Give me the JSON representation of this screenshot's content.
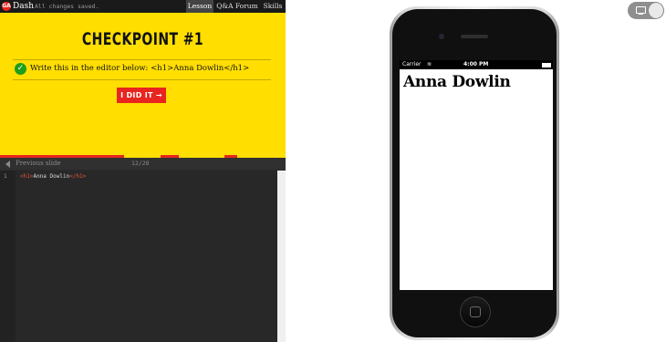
{
  "header": {
    "logo_text": "GA",
    "brand": "Dash",
    "save_status": "All changes saved.",
    "tabs": [
      {
        "label": "Lesson",
        "active": true
      },
      {
        "label": "Q&A Forum",
        "active": false
      },
      {
        "label": "Skills",
        "active": false
      }
    ]
  },
  "lesson": {
    "title": "CHECKPOINT #1",
    "instruction": "Write this in the editor below: <h1>Anna Dowlin</h1>",
    "button_label": "I DID IT →"
  },
  "slide_nav": {
    "previous_label": "Previous slide",
    "counter": "12/28"
  },
  "editor": {
    "line_number": "1",
    "code_open_tag": "<h1>",
    "code_text": "Anna Dowlin",
    "code_close_tag": "</h1>"
  },
  "device": {
    "carrier": "Carrier",
    "wifi_icon": "≋",
    "time": "4:00 PM",
    "preview_heading": "Anna Dowlin"
  },
  "colors": {
    "lesson_bg": "#ffde00",
    "accent_red": "#e8251f",
    "check_green": "#1f9e1a",
    "editor_bg": "#282828"
  }
}
